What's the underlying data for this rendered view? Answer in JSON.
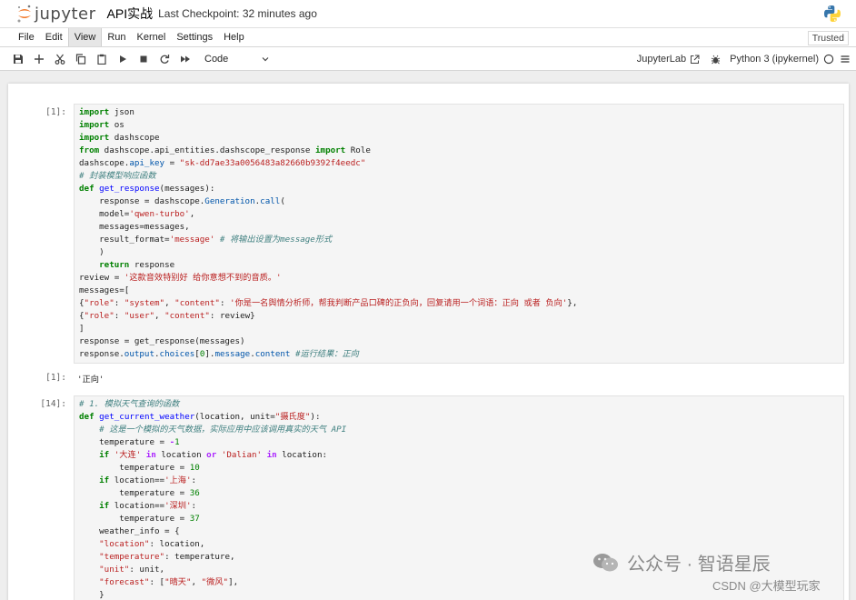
{
  "header": {
    "logo_text": "jupyter",
    "notebook_name": "API实战",
    "checkpoint": "Last Checkpoint: 32 minutes ago"
  },
  "menu": [
    "File",
    "Edit",
    "View",
    "Run",
    "Kernel",
    "Settings",
    "Help"
  ],
  "menu_active": "View",
  "trusted": "Trusted",
  "toolbar": {
    "cell_type": "Code",
    "jupyterlab": "JupyterLab",
    "kernel": "Python 3 (ipykernel)"
  },
  "cells": [
    {
      "prompt": "[1]:",
      "lines": [
        [
          [
            "kw",
            "import"
          ],
          [
            "t",
            " json"
          ]
        ],
        [
          [
            "kw",
            "import"
          ],
          [
            "t",
            " os"
          ]
        ],
        [
          [
            "kw",
            "import"
          ],
          [
            "t",
            " dashscope"
          ]
        ],
        [
          [
            "kw",
            "from"
          ],
          [
            "t",
            " dashscope.api_entities.dashscope_response "
          ],
          [
            "kw",
            "import"
          ],
          [
            "t",
            " Role"
          ]
        ],
        [
          [
            "t",
            "dashscope."
          ],
          [
            "attr",
            "api_key"
          ],
          [
            "t",
            " = "
          ],
          [
            "str",
            "\"sk-dd7ae33a0056483a82660b9392f4eedc\""
          ]
        ],
        [
          [
            "cm",
            "# 封装模型响应函数"
          ]
        ],
        [
          [
            "kw",
            "def"
          ],
          [
            "t",
            " "
          ],
          [
            "fn",
            "get_response"
          ],
          [
            "t",
            "(messages):"
          ]
        ],
        [
          [
            "t",
            "    response = dashscope."
          ],
          [
            "attr",
            "Generation"
          ],
          [
            "t",
            "."
          ],
          [
            "attr",
            "call"
          ],
          [
            "t",
            "("
          ]
        ],
        [
          [
            "t",
            "    model="
          ],
          [
            "str",
            "'qwen-turbo'"
          ],
          [
            "t",
            ","
          ]
        ],
        [
          [
            "t",
            "    messages=messages,"
          ]
        ],
        [
          [
            "t",
            "    result_format="
          ],
          [
            "str",
            "'message'"
          ],
          [
            "t",
            " "
          ],
          [
            "cm",
            "# 将输出设置为message形式"
          ]
        ],
        [
          [
            "t",
            "    )"
          ]
        ],
        [
          [
            "t",
            "    "
          ],
          [
            "kw",
            "return"
          ],
          [
            "t",
            " response"
          ]
        ],
        [
          [
            "t",
            "review = "
          ],
          [
            "str",
            "'这款音效特别好 给你意想不到的音质。'"
          ]
        ],
        [
          [
            "t",
            "messages=["
          ]
        ],
        [
          [
            "t",
            "{"
          ],
          [
            "str",
            "\"role\""
          ],
          [
            "t",
            ": "
          ],
          [
            "str",
            "\"system\""
          ],
          [
            "t",
            ", "
          ],
          [
            "str",
            "\"content\""
          ],
          [
            "t",
            ": "
          ],
          [
            "str",
            "'你是一名舆情分析师，帮我判断产品口碑的正负向，回复请用一个词语：正向 或者 负向'"
          ],
          [
            "t",
            "},"
          ]
        ],
        [
          [
            "t",
            "{"
          ],
          [
            "str",
            "\"role\""
          ],
          [
            "t",
            ": "
          ],
          [
            "str",
            "\"user\""
          ],
          [
            "t",
            ", "
          ],
          [
            "str",
            "\"content\""
          ],
          [
            "t",
            ": review}"
          ]
        ],
        [
          [
            "t",
            "]"
          ]
        ],
        [
          [
            "t",
            "response = get_response(messages)"
          ]
        ],
        [
          [
            "t",
            "response."
          ],
          [
            "attr",
            "output"
          ],
          [
            "t",
            "."
          ],
          [
            "attr",
            "choices"
          ],
          [
            "t",
            "["
          ],
          [
            "num",
            "0"
          ],
          [
            "t",
            "]."
          ],
          [
            "attr",
            "message"
          ],
          [
            "t",
            "."
          ],
          [
            "attr",
            "content"
          ],
          [
            "t",
            " "
          ],
          [
            "cm",
            "#运行结果：正向"
          ]
        ]
      ]
    },
    {
      "prompt": "[14]:",
      "lines": [
        [
          [
            "cm",
            "# 1. 模拟天气查询的函数"
          ]
        ],
        [
          [
            "kw",
            "def"
          ],
          [
            "t",
            " "
          ],
          [
            "fn",
            "get_current_weather"
          ],
          [
            "t",
            "(location, unit="
          ],
          [
            "str",
            "\"摄氏度\""
          ],
          [
            "t",
            "):"
          ]
        ],
        [
          [
            "t",
            "    "
          ],
          [
            "cm",
            "# 这是一个模拟的天气数据，实际应用中应该调用真实的天气 API"
          ]
        ],
        [
          [
            "t",
            "    temperature = "
          ],
          [
            "op",
            "-"
          ],
          [
            "num",
            "1"
          ]
        ],
        [
          [
            "t",
            "    "
          ],
          [
            "kw",
            "if"
          ],
          [
            "t",
            " "
          ],
          [
            "str",
            "'大连'"
          ],
          [
            "t",
            " "
          ],
          [
            "op",
            "in"
          ],
          [
            "t",
            " location "
          ],
          [
            "op",
            "or"
          ],
          [
            "t",
            " "
          ],
          [
            "str",
            "'Dalian'"
          ],
          [
            "t",
            " "
          ],
          [
            "op",
            "in"
          ],
          [
            "t",
            " location:"
          ]
        ],
        [
          [
            "t",
            "        temperature = "
          ],
          [
            "num",
            "10"
          ]
        ],
        [
          [
            "t",
            "    "
          ],
          [
            "kw",
            "if"
          ],
          [
            "t",
            " location=="
          ],
          [
            "str",
            "'上海'"
          ],
          [
            "t",
            ":"
          ]
        ],
        [
          [
            "t",
            "        temperature = "
          ],
          [
            "num",
            "36"
          ]
        ],
        [
          [
            "t",
            "    "
          ],
          [
            "kw",
            "if"
          ],
          [
            "t",
            " location=="
          ],
          [
            "str",
            "'深圳'"
          ],
          [
            "t",
            ":"
          ]
        ],
        [
          [
            "t",
            "        temperature = "
          ],
          [
            "num",
            "37"
          ]
        ],
        [
          [
            "t",
            "    weather_info = {"
          ]
        ],
        [
          [
            "t",
            "    "
          ],
          [
            "str",
            "\"location\""
          ],
          [
            "t",
            ": location,"
          ]
        ],
        [
          [
            "t",
            "    "
          ],
          [
            "str",
            "\"temperature\""
          ],
          [
            "t",
            ": temperature,"
          ]
        ],
        [
          [
            "t",
            "    "
          ],
          [
            "str",
            "\"unit\""
          ],
          [
            "t",
            ": unit,"
          ]
        ],
        [
          [
            "t",
            "    "
          ],
          [
            "str",
            "\"forecast\""
          ],
          [
            "t",
            ": ["
          ],
          [
            "str",
            "\"晴天\""
          ],
          [
            "t",
            ", "
          ],
          [
            "str",
            "\"微风\""
          ],
          [
            "t",
            "],"
          ]
        ],
        [
          [
            "t",
            "    }"
          ]
        ]
      ]
    }
  ],
  "output1": {
    "prompt": "[1]:",
    "text": "'正向'"
  },
  "watermark": {
    "text": "公众号 · 智语星辰",
    "csdn": "CSDN @大模型玩家"
  },
  "colors": {
    "keyword": "#008000",
    "string": "#ba2121",
    "comment": "#408080",
    "jupyter_orange": "#f37726"
  }
}
